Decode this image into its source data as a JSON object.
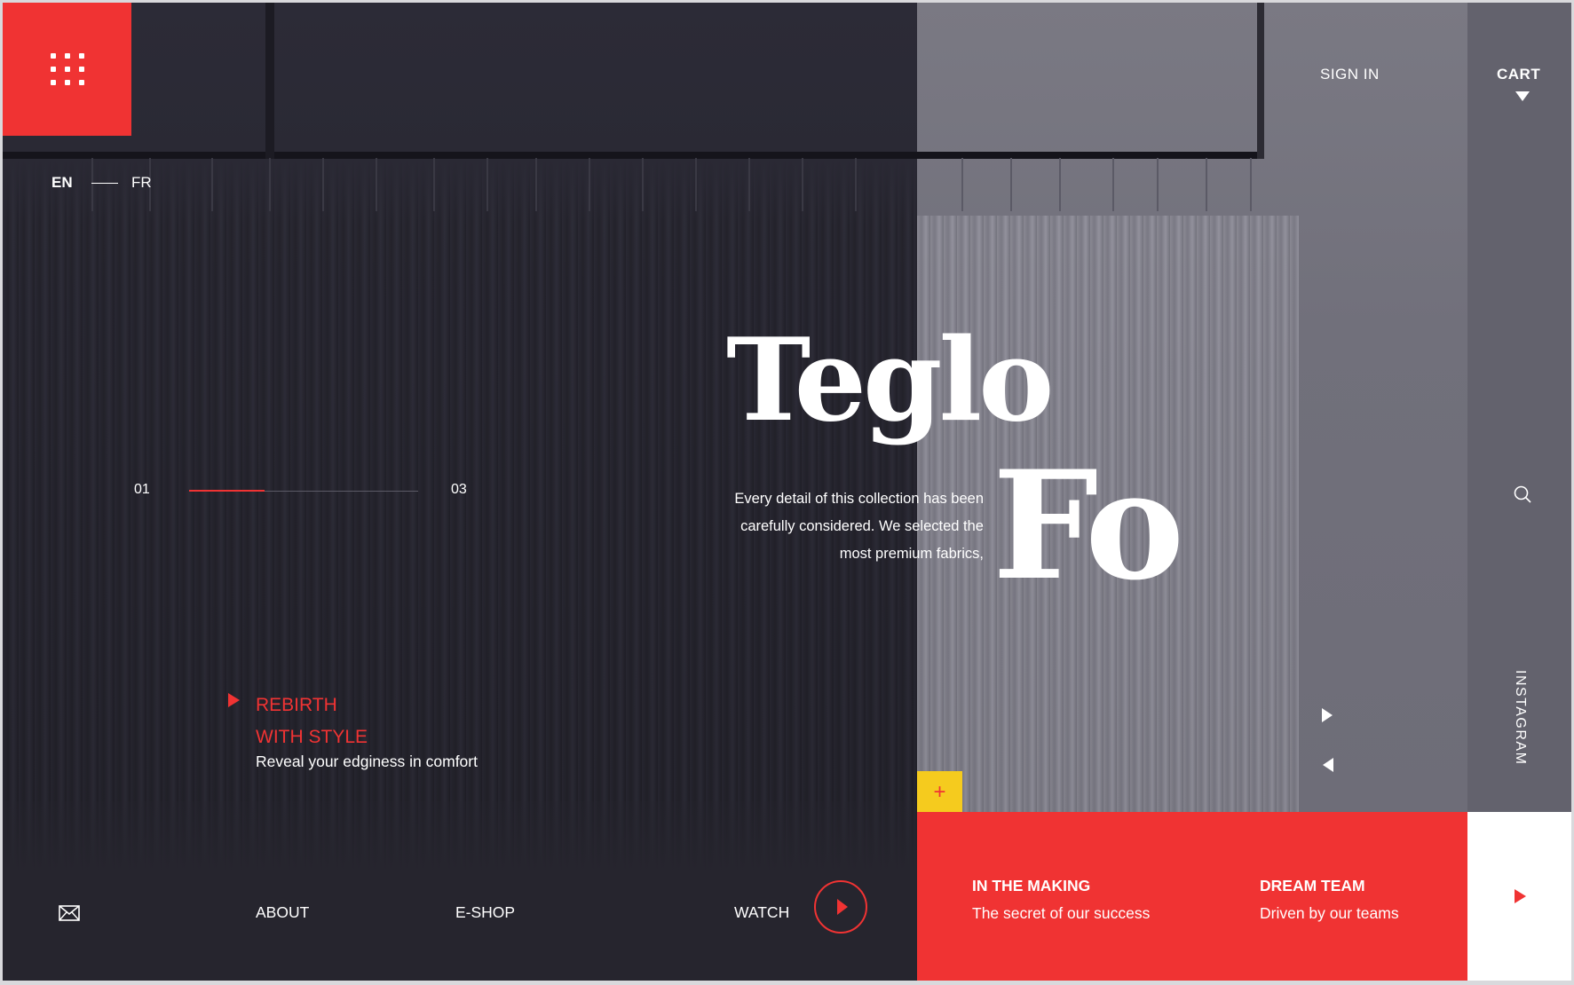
{
  "header": {
    "sign_in": "SIGN IN",
    "cart": "CART"
  },
  "language": {
    "active": "EN",
    "other": "FR"
  },
  "slider": {
    "current": "01",
    "total": "03",
    "progress": 0.33
  },
  "hero": {
    "title_line1": "Teglo",
    "title_line2": "Fo",
    "intro": "Every detail of this collection has been carefully considered. We selected the most premium fabrics,"
  },
  "feature": {
    "title_line1": "REBIRTH",
    "title_line2": "WITH STYLE",
    "subtitle": "Reveal your edginess in comfort"
  },
  "social": {
    "instagram": "INSTAGRAM"
  },
  "plus_button": "+",
  "cards": [
    {
      "title": "IN THE MAKING",
      "subtitle": "The secret of our success"
    },
    {
      "title": "DREAM TEAM",
      "subtitle": "Driven by our teams"
    }
  ],
  "bottom_nav": {
    "about": "ABOUT",
    "eshop": "E-SHOP",
    "watch": "WATCH"
  },
  "colors": {
    "accent_red": "#f03333",
    "accent_yellow": "#f5cb1e",
    "dark_bg": "#26252e",
    "light_panel": "#7a7983"
  },
  "icons": [
    "menu-grid-icon",
    "search-icon",
    "mail-icon",
    "play-icon",
    "arrow-right-icon",
    "arrow-left-icon",
    "cart-dropdown-icon"
  ]
}
